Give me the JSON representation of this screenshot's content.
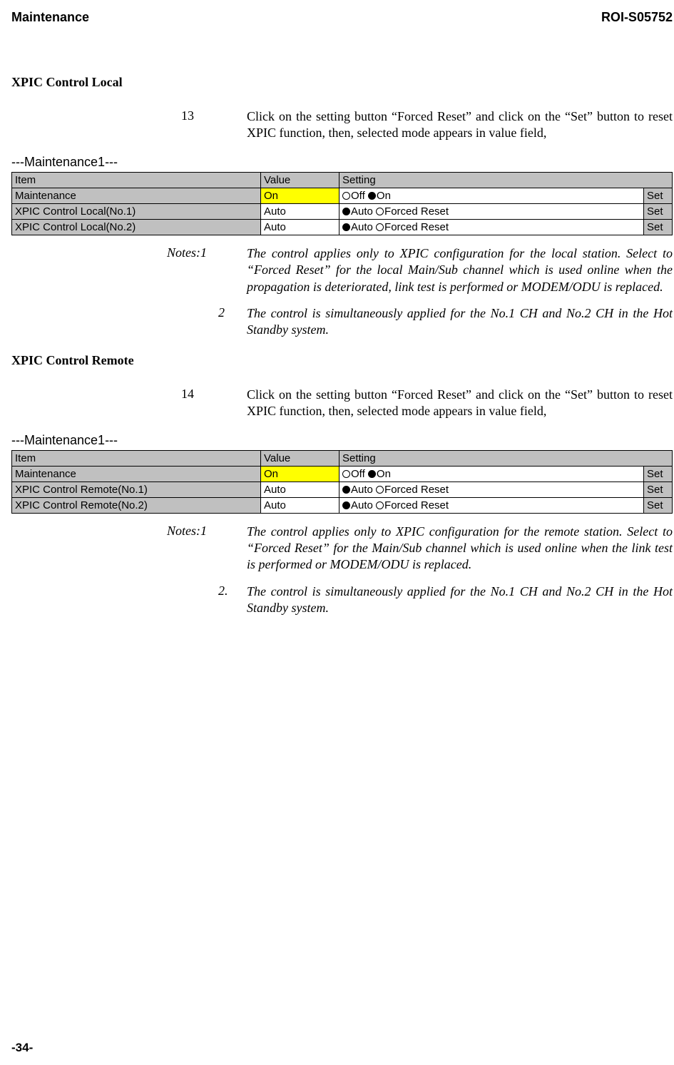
{
  "header": {
    "left": "Maintenance",
    "right": "ROI-S05752"
  },
  "footer": "-34-",
  "tableLabel": "---Maintenance1---",
  "tableHeaders": {
    "item": "Item",
    "value": "Value",
    "setting": "Setting"
  },
  "setLabel": "Set",
  "radios": {
    "off": "Off",
    "on": "On",
    "auto": "Auto",
    "forced": "Forced Reset"
  },
  "s1": {
    "heading": "XPIC Control Local",
    "step": {
      "num": "13",
      "text": "Click on the setting button “Forced Reset” and click on the “Set” button to reset XPIC function, then, selected mode appears in value field,"
    },
    "rows": [
      {
        "item": "Maintenance",
        "value": "On",
        "yellow": true,
        "type": "offon"
      },
      {
        "item": "XPIC Control Local(No.1)",
        "value": "Auto",
        "yellow": false,
        "type": "autoforced"
      },
      {
        "item": "XPIC Control Local(No.2)",
        "value": "Auto",
        "yellow": false,
        "type": "autoforced"
      }
    ],
    "notes": [
      {
        "label": "Notes:1",
        "num": "",
        "text": "The control applies only to XPIC configuration for the local station. Select to “Forced Reset” for the local Main/Sub channel which is used online when the propagation is deteriorated, link test is performed or MODEM/ODU is replaced."
      },
      {
        "label": "",
        "num": "2",
        "text": "The control is simultaneously applied for the No.1 CH and No.2 CH in the Hot Standby system."
      }
    ]
  },
  "s2": {
    "heading": "XPIC Control Remote",
    "step": {
      "num": "14",
      "text": "Click on the setting button “Forced Reset” and click on the “Set” button to reset XPIC function, then, selected mode appears in value field,"
    },
    "rows": [
      {
        "item": "Maintenance",
        "value": "On",
        "yellow": true,
        "type": "offon"
      },
      {
        "item": "XPIC Control Remote(No.1)",
        "value": "Auto",
        "yellow": false,
        "type": "autoforced"
      },
      {
        "item": "XPIC Control Remote(No.2)",
        "value": "Auto",
        "yellow": false,
        "type": "autoforced"
      }
    ],
    "notes": [
      {
        "label": "Notes:1",
        "num": "",
        "text": "The control applies only to XPIC configuration for the remote station. Select to “Forced Reset” for the Main/Sub channel which is used online when the link test is performed or MODEM/ODU is replaced."
      },
      {
        "label": "",
        "num": "2.",
        "text": "The control is simultaneously applied for the No.1 CH and No.2 CH in the Hot Standby system."
      }
    ]
  }
}
